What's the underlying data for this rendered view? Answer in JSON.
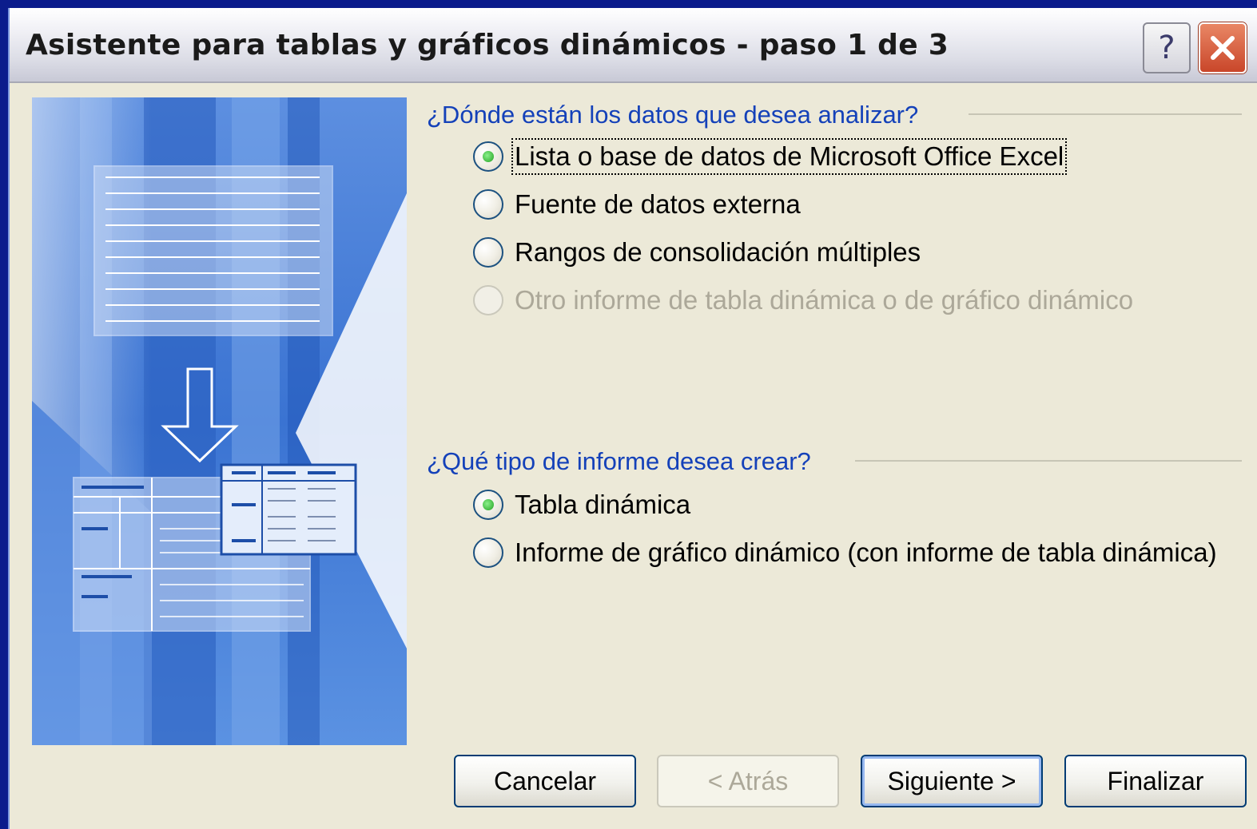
{
  "window": {
    "title": "Asistente para tablas y gráficos dinámicos - paso 1 de 3",
    "help_label": "?"
  },
  "section1": {
    "label": "¿Dónde están los datos que desea analizar?",
    "options": [
      {
        "label": "Lista o base de datos de Microsoft Office Excel",
        "selected": true,
        "enabled": true
      },
      {
        "label": "Fuente de datos externa",
        "selected": false,
        "enabled": true
      },
      {
        "label": "Rangos de consolidación múltiples",
        "selected": false,
        "enabled": true
      },
      {
        "label": "Otro informe de tabla dinámica o de gráfico dinámico",
        "selected": false,
        "enabled": false
      }
    ]
  },
  "section2": {
    "label": "¿Qué tipo de informe desea crear?",
    "options": [
      {
        "label": "Tabla dinámica",
        "selected": true,
        "enabled": true
      },
      {
        "label": "Informe de gráfico dinámico (con informe de tabla dinámica)",
        "selected": false,
        "enabled": true
      }
    ]
  },
  "buttons": {
    "cancel": "Cancelar",
    "back": "< Atrás",
    "next": "Siguiente >",
    "finish": "Finalizar"
  },
  "colors": {
    "section_label": "#1441b9",
    "close_button": "#c9462a",
    "illustration_blue": "#2f6fd0",
    "selected_dot": "#21a121"
  }
}
